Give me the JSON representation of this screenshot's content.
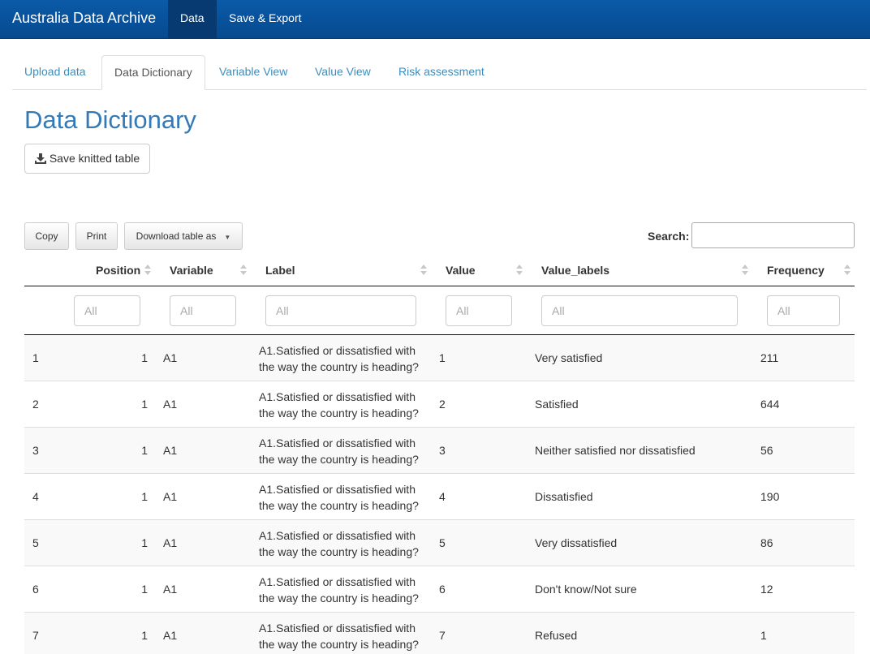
{
  "navbar": {
    "brand": "Australia Data Archive",
    "items": [
      {
        "label": "Data",
        "active": true
      },
      {
        "label": "Save & Export",
        "active": false
      }
    ]
  },
  "tabs": [
    {
      "label": "Upload data",
      "active": false
    },
    {
      "label": "Data Dictionary",
      "active": true
    },
    {
      "label": "Variable View",
      "active": false
    },
    {
      "label": "Value View",
      "active": false
    },
    {
      "label": "Risk assessment",
      "active": false
    }
  ],
  "page": {
    "title": "Data Dictionary",
    "save_button": "Save knitted table"
  },
  "toolbar": {
    "copy": "Copy",
    "print": "Print",
    "download": "Download table as",
    "search_label": "Search:",
    "search_value": ""
  },
  "table": {
    "columns": [
      "Position",
      "Variable",
      "Label",
      "Value",
      "Value_labels",
      "Frequency"
    ],
    "filter_placeholder": "All",
    "rows": [
      {
        "index": "1",
        "position": "1",
        "variable": "A1",
        "label": "A1.Satisfied or dissatisfied with the way the country is heading?",
        "value": "1",
        "value_label": "Very satisfied",
        "frequency": "211"
      },
      {
        "index": "2",
        "position": "1",
        "variable": "A1",
        "label": "A1.Satisfied or dissatisfied with the way the country is heading?",
        "value": "2",
        "value_label": "Satisfied",
        "frequency": "644"
      },
      {
        "index": "3",
        "position": "1",
        "variable": "A1",
        "label": "A1.Satisfied or dissatisfied with the way the country is heading?",
        "value": "3",
        "value_label": "Neither satisfied nor dissatisfied",
        "frequency": "56"
      },
      {
        "index": "4",
        "position": "1",
        "variable": "A1",
        "label": "A1.Satisfied or dissatisfied with the way the country is heading?",
        "value": "4",
        "value_label": "Dissatisfied",
        "frequency": "190"
      },
      {
        "index": "5",
        "position": "1",
        "variable": "A1",
        "label": "A1.Satisfied or dissatisfied with the way the country is heading?",
        "value": "5",
        "value_label": "Very dissatisfied",
        "frequency": "86"
      },
      {
        "index": "6",
        "position": "1",
        "variable": "A1",
        "label": "A1.Satisfied or dissatisfied with the way the country is heading?",
        "value": "6",
        "value_label": "Don't know/Not sure",
        "frequency": "12"
      },
      {
        "index": "7",
        "position": "1",
        "variable": "A1",
        "label": "A1.Satisfied or dissatisfied with the way the country is heading?",
        "value": "7",
        "value_label": "Refused",
        "frequency": "1"
      }
    ]
  },
  "colors": {
    "navbar": "#0a5aa8",
    "link": "#3c8dbc",
    "title": "#337ab7"
  }
}
